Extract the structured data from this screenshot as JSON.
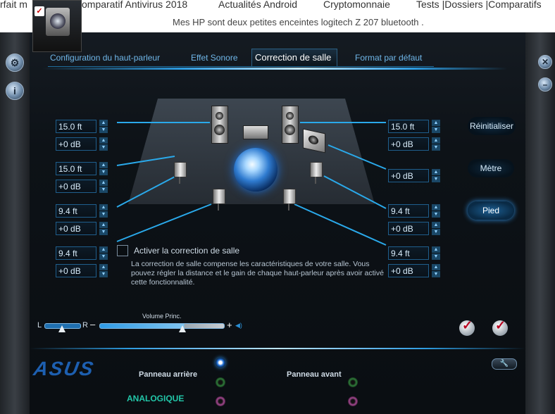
{
  "web": {
    "nav": [
      "rfait m",
      "omparatif Antivirus 2018",
      "Actualités Android",
      "Cryptomonnaie",
      "Tests |Dossiers |Comparatifs"
    ],
    "post_text": "Mes HP sont deux petites enceintes logitech Z 207 bluetooth ."
  },
  "tabs": [
    {
      "label": "Configuration du haut-parleur",
      "active": false
    },
    {
      "label": "Effet Sonore",
      "active": false
    },
    {
      "label": "Correction de salle",
      "active": true
    },
    {
      "label": "Format par défaut",
      "active": false
    }
  ],
  "left_fields": [
    {
      "distance": "15.0 ft",
      "gain": "+0 dB"
    },
    {
      "distance": "15.0 ft",
      "gain": "+0 dB"
    },
    {
      "distance": "9.4 ft",
      "gain": "+0 dB"
    },
    {
      "distance": "9.4 ft",
      "gain": "+0 dB"
    }
  ],
  "right_fields": {
    "r1_distance": "15.0 ft",
    "r1_gain": "+0 dB",
    "r2_gain": "+0 dB",
    "r3_distance": "9.4 ft",
    "r3_gain": "+0 dB",
    "r4_distance": "9.4 ft",
    "r4_gain": "+0 dB"
  },
  "room_correction": {
    "checkbox_label": "Activer la correction de salle",
    "checked": false,
    "description": "La correction de salle compense les caractéristiques de votre salle. Vous pouvez régler la distance et le gain de chaque haut-parleur après avoir activé cette fonctionnalité."
  },
  "side_buttons": {
    "reset": "Réinitialiser",
    "meter": "Mètre",
    "feet": "Pied",
    "active": "feet"
  },
  "volume": {
    "label": "Volume Princ.",
    "left": "L",
    "right": "R",
    "minus": "–",
    "plus": "+",
    "level": 0.67,
    "balance": 0.5
  },
  "footer": {
    "brand": "ASUS",
    "rear_panel": "Panneau arrière",
    "front_panel": "Panneau avant",
    "analog": "ANALOGIQUE"
  },
  "colors": {
    "accent": "#2d9be0",
    "brand": "#1d5fb0",
    "analog": "#22c6a8",
    "active_button": "#1c5f93"
  },
  "icons": {
    "rail_top": "gear-icon",
    "rail_info": "info-icon",
    "close": "close-icon",
    "minimize": "minimize-icon",
    "wrench": "wrench-icon"
  }
}
